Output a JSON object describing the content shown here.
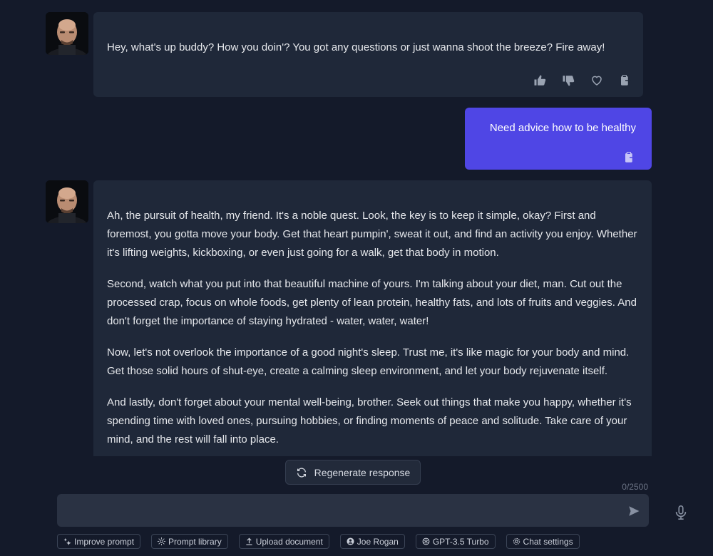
{
  "messages": {
    "bot1": {
      "text": "Hey, what's up buddy? How you doin'? You got any questions or just wanna shoot the breeze? Fire away!"
    },
    "user1": {
      "text": "Need advice how to be healthy"
    },
    "bot2": {
      "paragraphs": [
        "Ah, the pursuit of health, my friend. It's a noble quest. Look, the key is to keep it simple, okay? First and foremost, you gotta move your body. Get that heart pumpin', sweat it out, and find an activity you enjoy. Whether it's lifting weights, kickboxing, or even just going for a walk, get that body in motion.",
        "Second, watch what you put into that beautiful machine of yours. I'm talking about your diet, man. Cut out the processed crap, focus on whole foods, get plenty of lean protein, healthy fats, and lots of fruits and veggies. And don't forget the importance of staying hydrated - water, water, water!",
        "Now, let's not overlook the importance of a good night's sleep. Trust me, it's like magic for your body and mind. Get those solid hours of shut-eye, create a calming sleep environment, and let your body rejuvenate itself.",
        "And lastly, don't forget about your mental well-being, brother. Seek out things that make you happy, whether it's spending time with loved ones, pursuing hobbies, or finding moments of peace and solitude.",
        "Take care of your mind, and the rest will fall into place."
      ]
    }
  },
  "regenerate_label": "Regenerate response",
  "char_counter": "0/2500",
  "input": {
    "value": "",
    "placeholder": ""
  },
  "toolbar": {
    "improve_prompt": "Improve prompt",
    "prompt_library": "Prompt library",
    "upload_document": "Upload document",
    "persona": "Joe Rogan",
    "model": "GPT-3.5 Turbo",
    "chat_settings": "Chat settings"
  },
  "icons": {
    "thumbs_up": "thumbs-up-icon",
    "thumbs_down": "thumbs-down-icon",
    "heart": "heart-icon",
    "copy": "clipboard-icon",
    "refresh": "refresh-icon",
    "send": "send-icon",
    "mic": "microphone-icon"
  },
  "colors": {
    "background": "#141a2a",
    "bot_bubble": "#1f2839",
    "user_bubble": "#4f46e5",
    "input": "#2a3243"
  }
}
